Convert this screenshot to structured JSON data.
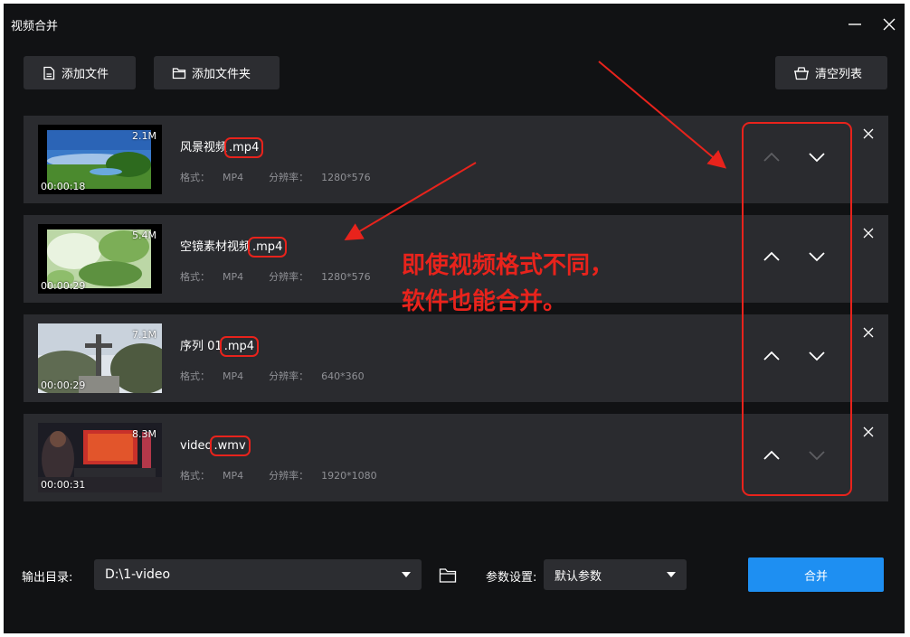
{
  "window": {
    "title": "视频合并"
  },
  "toolbar": {
    "add_file": "添加文件",
    "add_folder": "添加文件夹",
    "clear_list": "清空列表"
  },
  "meta_labels": {
    "format": "格式：",
    "resolution": "分辨率："
  },
  "items": [
    {
      "name": "风景视频",
      "ext": ".mp4",
      "size": "2.1M",
      "duration": "00:00:18",
      "format": "MP4",
      "resolution": "1280*576",
      "up_enabled": false,
      "down_enabled": true
    },
    {
      "name": "空镜素材视频",
      "ext": ".mp4",
      "size": "5.4M",
      "duration": "00:00:29",
      "format": "MP4",
      "resolution": "1280*576",
      "up_enabled": true,
      "down_enabled": true
    },
    {
      "name": "序列 01",
      "ext": ".mp4",
      "size": "7.1M",
      "duration": "00:00:29",
      "format": "MP4",
      "resolution": "640*360",
      "up_enabled": true,
      "down_enabled": true
    },
    {
      "name": "video",
      "ext": ".wmv",
      "size": "8.3M",
      "duration": "00:00:31",
      "format": "MP4",
      "resolution": "1920*1080",
      "up_enabled": true,
      "down_enabled": false
    }
  ],
  "annotation": {
    "line1": "即使视频格式不同，",
    "line2": "软件也能合并。",
    "color": "#e8231c"
  },
  "output": {
    "label": "输出目录:",
    "path": "D:\\1-video"
  },
  "params": {
    "label": "参数设置:",
    "value": "默认参数"
  },
  "merge_label": "合并",
  "colors": {
    "accent": "#1e8ff2",
    "bg": "#111214",
    "panel": "#2a2b2f",
    "annotation": "#e8231c"
  }
}
